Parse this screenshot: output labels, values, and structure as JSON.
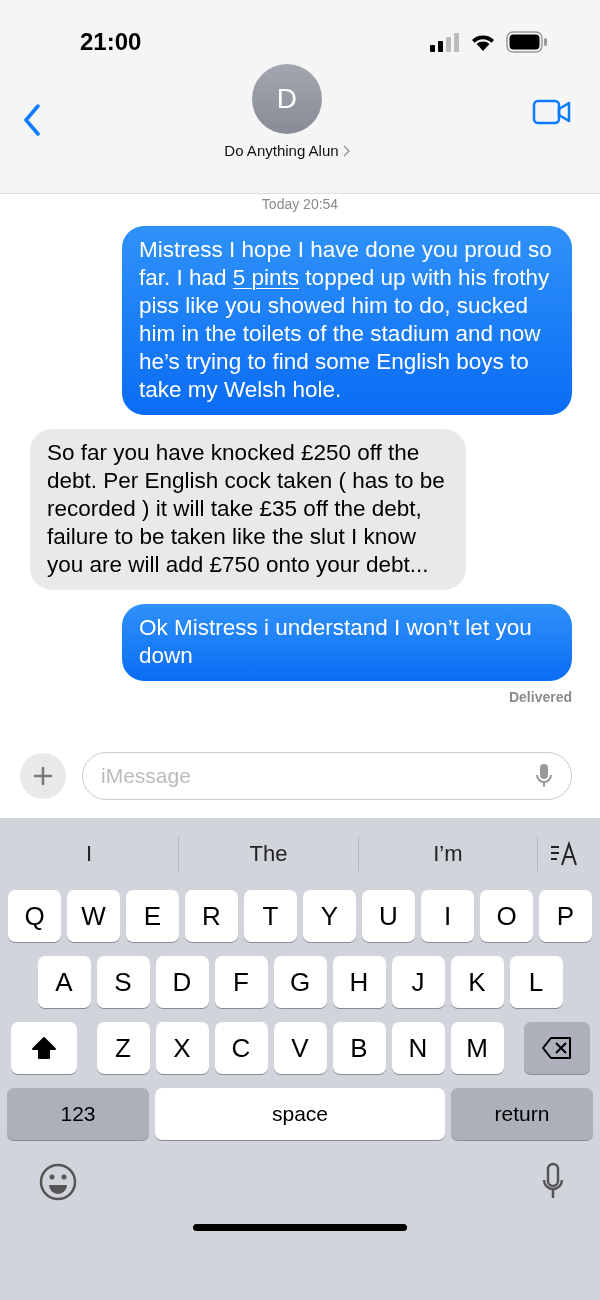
{
  "status_bar": {
    "time": "21:00"
  },
  "header": {
    "avatar_initial": "D",
    "contact_name": "Do Anything Alun"
  },
  "timestamp": "Today 20:54",
  "messages": [
    {
      "kind": "sent",
      "parts": [
        {
          "kind": "plain",
          "text": "Mistress I hope I have done you proud so far. I had "
        },
        {
          "kind": "link",
          "text": "5 pints"
        },
        {
          "kind": "plain",
          "text": " topped up with his frothy piss like you showed him to do, sucked him in the toilets of the stadium and now he’s trying to find some English boys to take my Welsh hole."
        }
      ]
    },
    {
      "kind": "received",
      "parts": [
        {
          "kind": "plain",
          "text": "So far you have knocked £250 off the debt. Per English cock taken ( has to be recorded ) it will take £35 off the debt, failure to be taken like the slut I know you are will add £750 onto your debt..."
        }
      ]
    },
    {
      "kind": "sent",
      "parts": [
        {
          "kind": "plain",
          "text": "Ok Mistress i understand I won’t let you down"
        }
      ]
    }
  ],
  "delivery_status": "Delivered",
  "composer": {
    "placeholder": "iMessage"
  },
  "suggestions": [
    "I",
    "The",
    "I’m"
  ],
  "keyboard": {
    "rows": [
      [
        "Q",
        "W",
        "E",
        "R",
        "T",
        "Y",
        "U",
        "I",
        "O",
        "P"
      ],
      [
        "A",
        "S",
        "D",
        "F",
        "G",
        "H",
        "J",
        "K",
        "L"
      ],
      [
        "Z",
        "X",
        "C",
        "V",
        "B",
        "N",
        "M"
      ]
    ],
    "shift": {
      "on": true
    },
    "numbers_key": "123",
    "space_key": "space",
    "return_key": "return"
  }
}
